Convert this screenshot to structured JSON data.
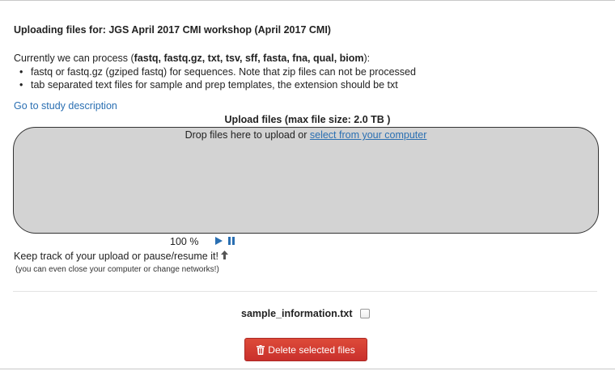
{
  "page": {
    "heading": "Uploading files for: JGS April 2017 CMI workshop (April 2017 CMI)"
  },
  "intro": {
    "prefix": "Currently we can process (",
    "formats": "fastq, fastq.gz, txt, tsv, sff, fasta, fna, qual, biom",
    "suffix": "):",
    "bullets": [
      "fastq or fastq.gz (gziped fastq) for sequences. Note that zip files can not be processed",
      "tab separated text files for sample and prep templates, the extension should be txt"
    ]
  },
  "study_link": "Go to study description",
  "upload": {
    "title": "Upload files (max file size: 2.0 TB )",
    "drop_prefix": "Drop files here to upload or ",
    "drop_link": "select from your computer",
    "progress": "100 %",
    "progress_value": 100,
    "track_text": "Keep track of your upload or pause/resume it!",
    "close_note": "(you can even close your computer or change networks!)"
  },
  "files": [
    {
      "name": "sample_information.txt",
      "checked": false
    }
  ],
  "delete_button": "Delete selected files",
  "colors": {
    "link": "#2a6fb2",
    "dropzone": "#d3d3d3",
    "danger": "#d9534f"
  },
  "icons": {
    "play": "play-icon",
    "pause": "pause-icon",
    "arrow": "up-arrow-icon",
    "trash": "trash-icon"
  }
}
